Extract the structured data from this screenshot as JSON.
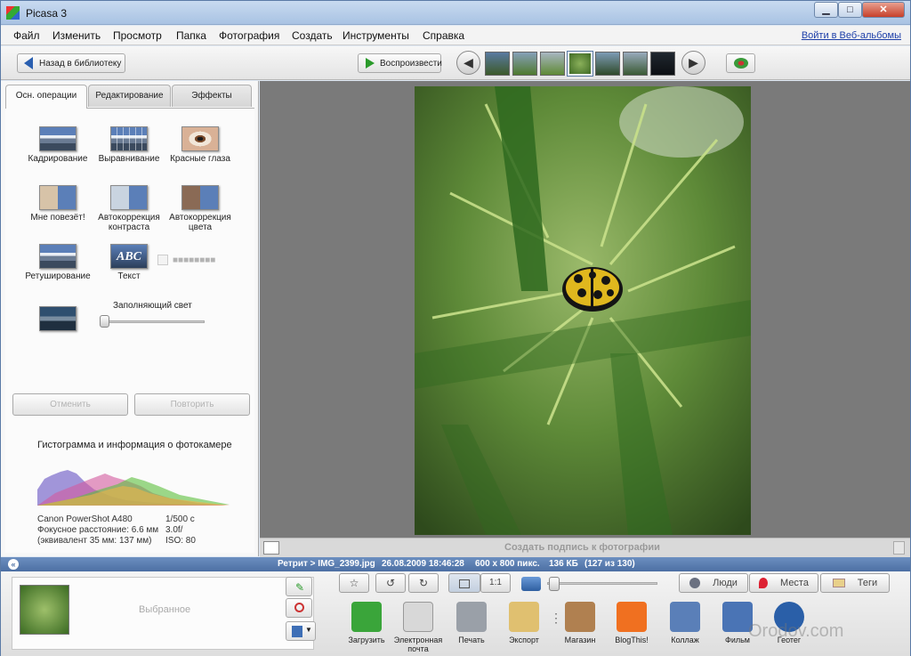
{
  "window": {
    "title": "Picasa 3",
    "controls": {
      "minimize": "▁",
      "maximize": "□",
      "close": "✕"
    }
  },
  "menu": {
    "items": [
      "Файл",
      "Изменить",
      "Просмотр",
      "Папка",
      "Фотография",
      "Создать",
      "Инструменты",
      "Справка"
    ],
    "web_link": "Войти в Веб-альбомы"
  },
  "toolbar": {
    "back_label": "Назад в библиотеку",
    "play_label": "Воспроизвести",
    "prev_icon": "arrow-left",
    "next_icon": "arrow-right"
  },
  "tabs": [
    "Осн. операции",
    "Редактирование",
    "Эффекты"
  ],
  "tools": {
    "crop": "Кадрирование",
    "straighten": "Выравнивание",
    "redeye": "Красные глаза",
    "lucky": "Мне повезёт!",
    "autocontrast_1": "Автокоррекция",
    "autocontrast_2": "контраста",
    "autocolor_1": "Автокоррекция",
    "autocolor_2": "цвета",
    "retouch": "Ретуширование",
    "text": "Текст",
    "text_icon": "ABC",
    "fill_light": "Заполняющий свет",
    "fill_light_value": 0
  },
  "undo_label": "Отменить",
  "redo_label": "Повторить",
  "histogram": {
    "title": "Гистограмма и информация о фотокамере",
    "camera": "Canon PowerShot A480",
    "focal": "Фокусное расстояние: 6.6 мм",
    "equiv": "(эквивалент 35 мм: 137 мм)",
    "shutter": "1/500 с",
    "aperture": "3.0f/",
    "iso": "ISO: 80"
  },
  "caption_placeholder": "Создать подпись к фотографии",
  "status": {
    "path": "Ретрит > IMG_2399.jpg",
    "datetime": "26.08.2009 18:46:28",
    "dims": "600 x 800 пикс.",
    "size": "136 КБ",
    "index": "(127 из 130)"
  },
  "tray": {
    "label": "Выбранное"
  },
  "bottom_buttons": {
    "one_to_one": "1:1",
    "people": "Люди",
    "places": "Места",
    "tags": "Теги"
  },
  "actions": [
    {
      "label": "Загрузить",
      "color": "#3aa53a"
    },
    {
      "label": "Электронная почта",
      "color": "#d8d8d8"
    },
    {
      "label": "Печать",
      "color": "#9aa0a8"
    },
    {
      "label": "Экспорт",
      "color": "#e0c070"
    },
    {
      "label": "Магазин",
      "color": "#b08050"
    },
    {
      "label": "BlogThis!",
      "color": "#f07020"
    },
    {
      "label": "Коллаж",
      "color": "#5a7fb8"
    },
    {
      "label": "Фильм",
      "color": "#4a74b5"
    },
    {
      "label": "Геотег",
      "color": "#2a5fa8"
    }
  ],
  "watermark": "Orodov.com"
}
